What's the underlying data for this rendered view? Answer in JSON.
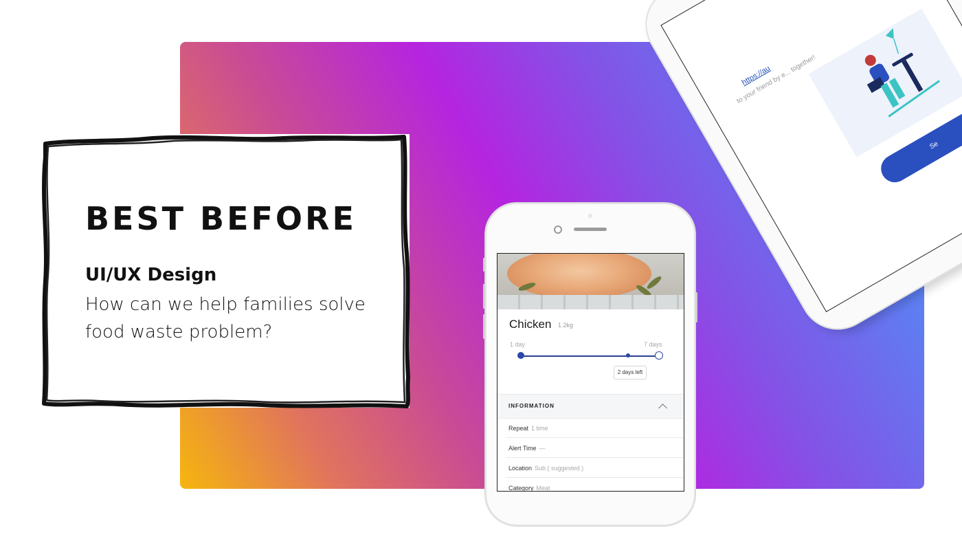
{
  "card": {
    "title": "BEST BEFORE",
    "subtitle": "UI/UX Design",
    "description": "How can we help families solve food waste problem?"
  },
  "app": {
    "food": {
      "name": "Chicken",
      "weight": "1.2kg"
    },
    "range": {
      "min_label": "1 day",
      "max_label": "7 days",
      "level": 0.86
    },
    "days_left": "2 days left",
    "info": {
      "title": "INFORMATION",
      "rows": [
        {
          "label": "Repeat",
          "value": "1 time"
        },
        {
          "label": "Alert Time",
          "value": "—"
        },
        {
          "label": "Location",
          "value": "Sub ( suggested )"
        },
        {
          "label": "Category",
          "value": "Meat"
        }
      ]
    }
  },
  "share_screen": {
    "link": "https://au",
    "message": "to your friend by e... together!",
    "button": "Se"
  },
  "colors": {
    "accent": "#2948a8",
    "gradient": [
      "#f6b60d",
      "#c94b95",
      "#b524e0",
      "#5a8cf6"
    ]
  },
  "icons": [
    "chevron-up-icon"
  ]
}
